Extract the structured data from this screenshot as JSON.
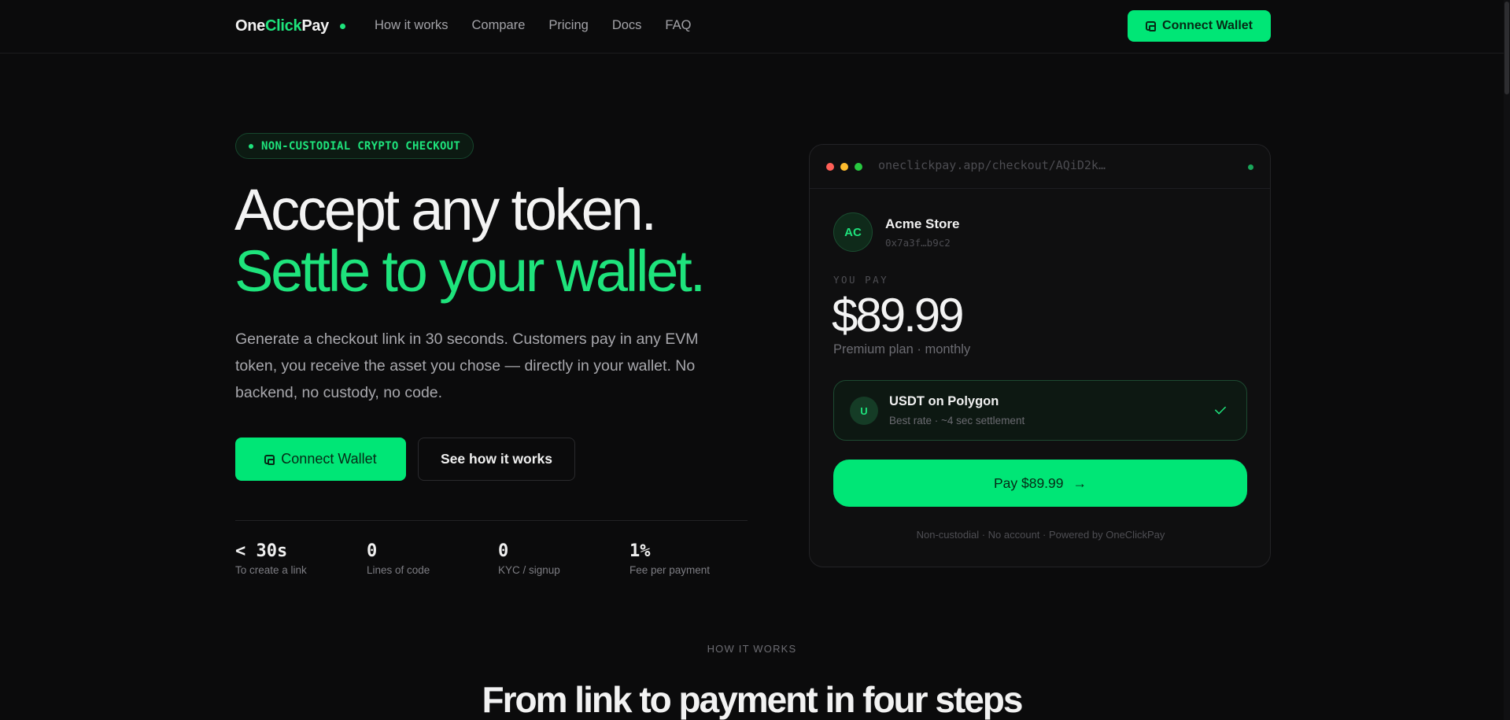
{
  "nav": {
    "logo_part1": "One",
    "logo_part2": "Click",
    "logo_part3": "Pay",
    "links": [
      "How it works",
      "Compare",
      "Pricing",
      "Docs",
      "FAQ"
    ],
    "cta_label": "Connect Wallet"
  },
  "hero": {
    "badge": "NON-CUSTODIAL CRYPTO CHECKOUT",
    "title_line1": "Accept any token.",
    "title_line2": "Settle to your wallet.",
    "lead": "Generate a checkout link in 30 seconds. Customers pay in any EVM token, you receive the asset you chose — directly in your wallet. No backend, no custody, no code.",
    "cta_primary": "Connect Wallet",
    "cta_secondary": "See how it works",
    "stats": [
      {
        "value": "< 30s",
        "label": "To create a link"
      },
      {
        "value": "0",
        "label": "Lines of code"
      },
      {
        "value": "0",
        "label": "KYC / signup"
      },
      {
        "value": "1%",
        "label": "Fee per payment"
      }
    ]
  },
  "checkout": {
    "url": "oneclickpay.app/checkout/AQiD2k…",
    "merchant_initials": "AC",
    "merchant_name": "Acme Store",
    "merchant_address": "0x7a3f…b9c2",
    "you_pay_label": "YOU PAY",
    "amount": "$89.99",
    "plan": "Premium plan · monthly",
    "token_icon": "U",
    "token_name": "USDT on Polygon",
    "token_sub": "Best rate · ~4 sec settlement",
    "pay_label": "Pay $89.99",
    "pay_arrow": "→",
    "footnote": "Non-custodial · No account · Powered by OneClickPay"
  },
  "how_it_works": {
    "eyebrow": "HOW IT WORKS",
    "title": "From link to payment in four steps"
  },
  "colors": {
    "accent": "#00e676",
    "background": "#0b0b0c"
  }
}
